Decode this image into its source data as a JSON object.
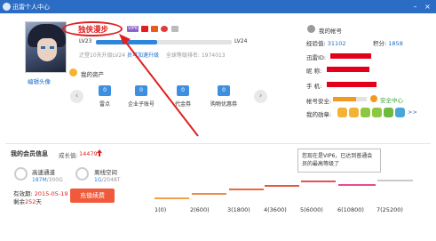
{
  "window": {
    "title": "迅雷个人中心"
  },
  "profile": {
    "username": "独侠漫步",
    "vip_badge": "VIP6",
    "edit_avatar": "编辑头像",
    "level_current": "LV23",
    "level_next": "LV24",
    "level_progress": 0.45,
    "today_text": "迂登10天升级LV24",
    "speedup_link": "员可加速升级",
    "rank_text": "全球等级排名: 1974013"
  },
  "assets": {
    "title": "我的资产",
    "items": [
      {
        "value": "0",
        "label": "雷点"
      },
      {
        "value": "0",
        "label": "企业子账号"
      },
      {
        "value": "0",
        "label": "代金券"
      },
      {
        "value": "0",
        "label": "购物优惠券"
      }
    ]
  },
  "account": {
    "title": "我的帐号",
    "exp_label": "经验值:",
    "exp_value": "31102",
    "points_label": "积分:",
    "points_value": "1858",
    "xunlei_id_label": "迅雷ID:",
    "nickname_label": "昵  称:",
    "mobile_label": "手  机:",
    "email_label": "邮  箱:",
    "security_label": "帐号安全:",
    "security_level": 0.68,
    "security_link": "安全中心",
    "medals_label": "我的勋章:",
    "medals_more": ">>"
  },
  "membership": {
    "title": "我的会员信息",
    "growth_label": "成长值:",
    "growth_value": "14479",
    "services": [
      {
        "name": "高速通道",
        "used": "187M",
        "total": "/300G"
      },
      {
        "name": "离线空间",
        "used": "1G",
        "total": "/2048T"
      }
    ],
    "valid_label": "有效期:",
    "valid_date": "2015-05-19",
    "remain_prefix": "剩余",
    "remain_days": "252",
    "remain_suffix": "天",
    "renew_button": "充值续费",
    "tooltip": "您现在是VIP6，已达到普通会员的最高等级了",
    "levels": [
      "1(0)",
      "2(600)",
      "3(1800)",
      "4(3600)",
      "5(6000)",
      "6(10800)",
      "7(25200)"
    ]
  },
  "colors": {
    "titlebar": "#2b6cc4",
    "accent_blue": "#1d6bc6",
    "annotation_red": "#e02020",
    "step_orange": "#f5a04a",
    "step_red": "#e8573a",
    "step_pink": "#e94b8c"
  },
  "icons": [
    "minimize-icon",
    "close-icon",
    "arrow-left-icon",
    "arrow-right-icon",
    "upgrade-arrow-icon"
  ]
}
